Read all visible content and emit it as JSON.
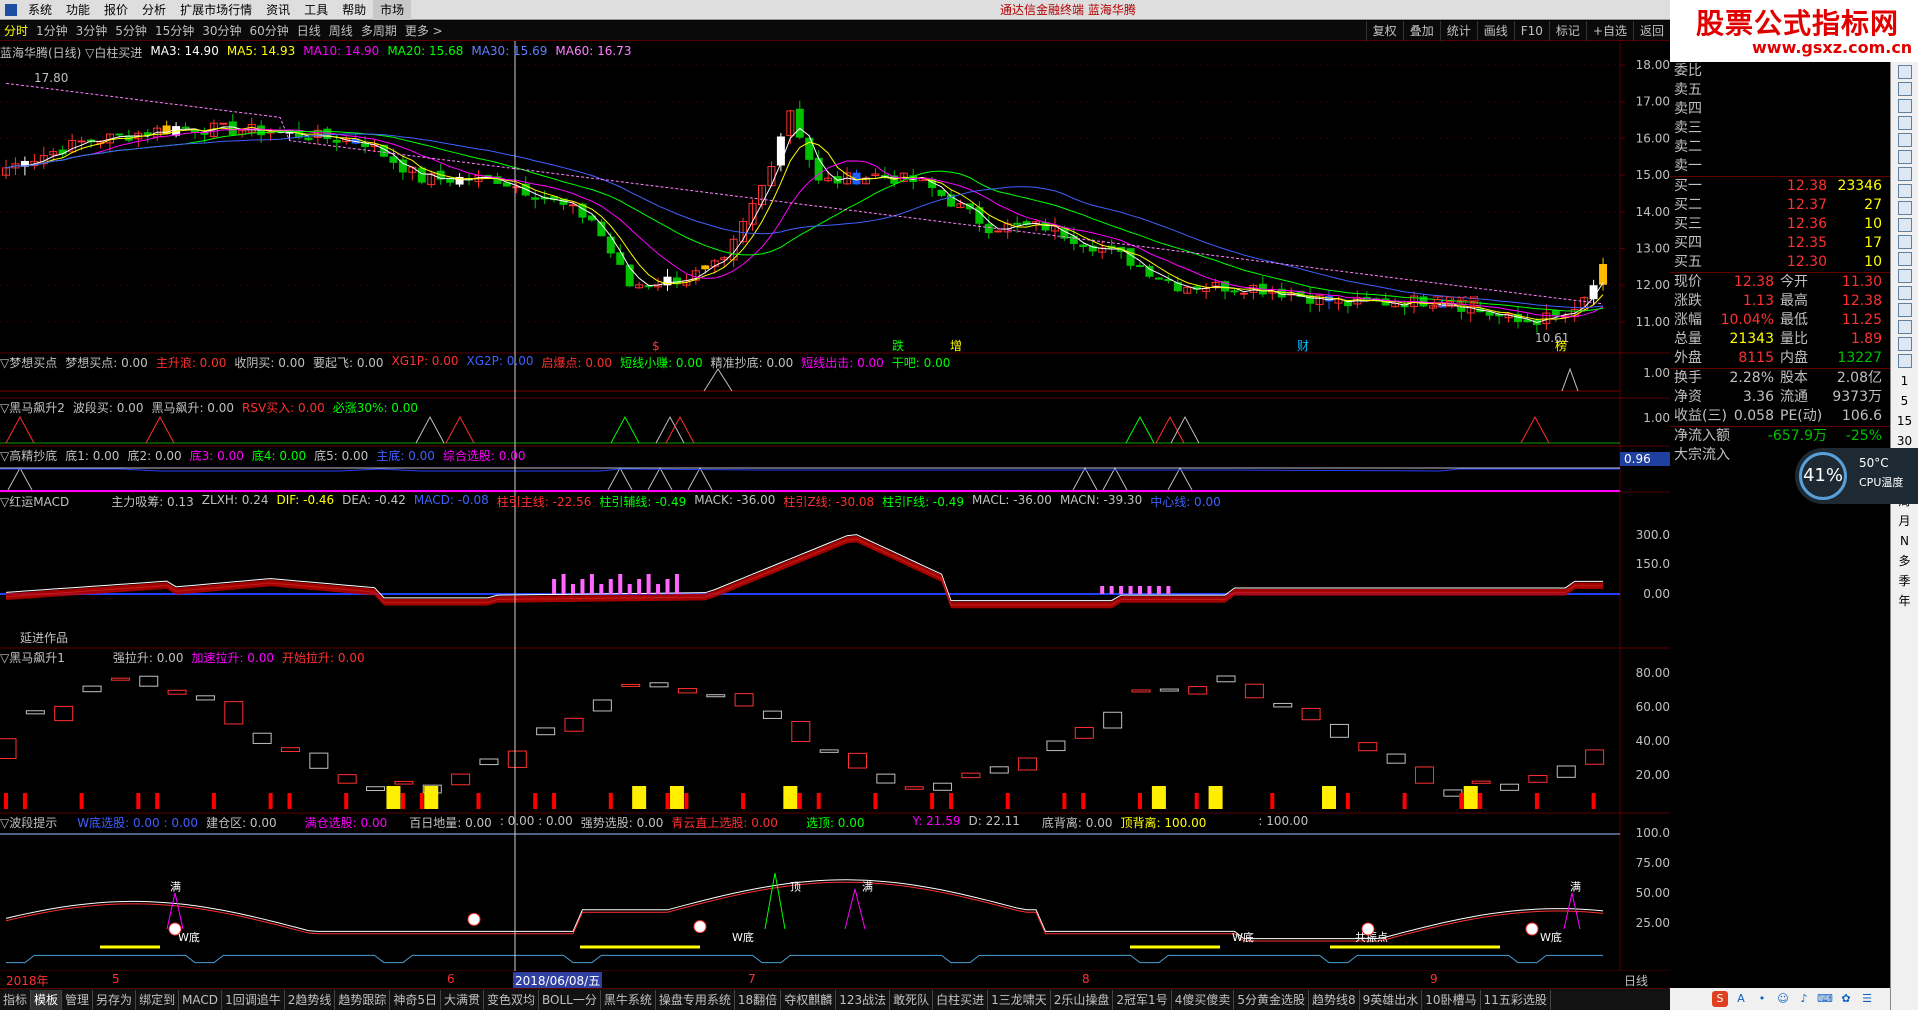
{
  "menu": {
    "items": [
      "系统",
      "功能",
      "报价",
      "分析",
      "扩展市场行情",
      "资讯",
      "工具",
      "帮助",
      "市场"
    ],
    "title": "通达信金融终端 蓝海华腾"
  },
  "period_tabs": [
    "分时",
    "1分钟",
    "3分钟",
    "5分钟",
    "15分钟",
    "30分钟",
    "60分钟",
    "日线",
    "周线",
    "多周期",
    "更多 >"
  ],
  "toolbar_right": [
    "复权",
    "叠加",
    "统计",
    "画线",
    "F10",
    "标记",
    "+自选",
    "返回"
  ],
  "brand": {
    "title": "股票公式指标网",
    "url": "www.gsxz.com.cn"
  },
  "main_info": {
    "name": "蓝海华腾(日线) ▽白柱买进",
    "ma3": "MA3: 14.90",
    "ma5": "MA5: 14.93",
    "ma10": "MA10: 14.90",
    "ma20": "MA20: 15.68",
    "ma30": "MA30: 15.69",
    "ma60": "MA60: 16.73"
  },
  "price_axis": [
    "18.00",
    "17.00",
    "16.00",
    "15.00",
    "14.00",
    "13.00",
    "12.00",
    "11.00"
  ],
  "price_labels": {
    "high": "17.80",
    "low": "10.61",
    "tag": "百日新量"
  },
  "chart_marks": [
    "$",
    "跌",
    "增",
    "财",
    "榜"
  ],
  "panel1": {
    "items": [
      "▽梦想买点",
      "梦想买点: 0.00",
      "主升浪: 0.00",
      "收阴买: 0.00",
      "要起飞: 0.00",
      "XG1P: 0.00",
      "XG2P: 0.00",
      "启爆点: 0.00",
      "短线小赚: 0.00",
      "精准抄底: 0.00",
      "短线出击: 0.00",
      "干吧: 0.00"
    ],
    "axis": "1.00"
  },
  "panel2": {
    "items": [
      "▽黑马飙升2",
      "波段买: 0.00",
      "黑马飙升: 0.00",
      "RSV买入: 0.00",
      "必涨30%: 0.00"
    ],
    "axis": "1.00"
  },
  "panel3": {
    "items": [
      "▽高精抄底",
      "底1: 0.00",
      "底2: 0.00",
      "底3: 0.00",
      "底4: 0.00",
      "底5: 0.00",
      "主底: 0.00",
      "综合选股: 0.00"
    ],
    "axis": "0.96"
  },
  "panel4": {
    "items": [
      "▽红运MACD",
      "主力吸筹: 0.13",
      "ZLXH: 0.24",
      "DIF: -0.46",
      "DEA: -0.42",
      "MACD: -0.08",
      "柱引主线: -22.56",
      "柱引辅线: -0.49",
      "MACK: -36.00",
      "柱引Z线: -30.08",
      "柱引F线: -0.49",
      "MACL: -36.00",
      "MACN: -39.30",
      "中心线: 0.00"
    ],
    "axis": [
      "300.0",
      "150.0",
      "0.00"
    ],
    "note": "延进作品"
  },
  "panel5": {
    "items": [
      "▽黑马飙升1",
      "强拉升: 0.00",
      "加速拉升: 0.00",
      "开始拉升: 0.00"
    ],
    "axis": [
      "80.00",
      "60.00",
      "40.00",
      "20.00"
    ]
  },
  "panel6": {
    "items": [
      "▽波段提示",
      "W底选股: 0.00 : 0.00",
      "建仓区: 0.00",
      "满仓选股: 0.00",
      "百日地量: 0.00",
      ": 0.00 : 0.00",
      "强势选股: 0.00",
      "青云直上选股: 0.00",
      "选顶: 0.00",
      "Y: 21.59",
      "D: 22.11",
      "底背离: 0.00",
      "顶背离: 100.00",
      ": 100.00"
    ],
    "axis": [
      "100.0",
      "75.00",
      "50.00",
      "25.00"
    ],
    "marks": [
      "满",
      "W底",
      "顶",
      "满",
      "W底",
      "W底",
      "共振点",
      "W底",
      "满"
    ]
  },
  "date_axis": {
    "labels": [
      "2018年",
      "5",
      "6",
      "2018/06/08/五",
      "7",
      "8",
      "9"
    ],
    "right": "日线"
  },
  "bottom_tabs": [
    "指标",
    "模板",
    "管理",
    "另存为",
    "绑定到",
    "MACD",
    "1回调追牛",
    "2趋势线",
    "趋势跟踪",
    "神奇5日",
    "大满贯",
    "变色双均",
    "BOLL一分",
    "黑牛系统",
    "操盘专用系统",
    "18翻倍",
    "夺权麒麟",
    "123战法",
    "敢死队",
    "白柱买进",
    "1三龙啸天",
    "2乐山操盘",
    "2冠军1号",
    "4傻买傻卖",
    "5分黄金选股",
    "趋势线8",
    "9英雄出水",
    "10卧槽马",
    "11五彩选股"
  ],
  "quote": {
    "asks": [
      {
        "l": "委比",
        "p": "",
        "v": ""
      },
      {
        "l": "卖五",
        "p": "",
        "v": ""
      },
      {
        "l": "卖四",
        "p": "",
        "v": ""
      },
      {
        "l": "卖三",
        "p": "",
        "v": ""
      },
      {
        "l": "卖二",
        "p": "",
        "v": ""
      },
      {
        "l": "卖一",
        "p": "",
        "v": ""
      }
    ],
    "bids": [
      {
        "l": "买一",
        "p": "12.38",
        "v": "23346"
      },
      {
        "l": "买二",
        "p": "12.37",
        "v": "27"
      },
      {
        "l": "买三",
        "p": "12.36",
        "v": "10"
      },
      {
        "l": "买四",
        "p": "12.35",
        "v": "17"
      },
      {
        "l": "买五",
        "p": "12.30",
        "v": "10"
      }
    ],
    "stats": [
      {
        "l1": "现价",
        "v1": "12.38",
        "l2": "今开",
        "v2": "11.30"
      },
      {
        "l1": "涨跌",
        "v1": "1.13",
        "l2": "最高",
        "v2": "12.38"
      },
      {
        "l1": "涨幅",
        "v1": "10.04%",
        "l2": "最低",
        "v2": "11.25"
      },
      {
        "l1": "总量",
        "v1": "21343",
        "l2": "量比",
        "v2": "1.89"
      },
      {
        "l1": "外盘",
        "v1": "8115",
        "l2": "内盘",
        "v2": "13227"
      }
    ],
    "stats2": [
      {
        "l1": "换手",
        "v1": "2.28%",
        "l2": "股本",
        "v2": "2.08亿"
      },
      {
        "l1": "净资",
        "v1": "3.36",
        "l2": "流通",
        "v2": "9373万"
      },
      {
        "l1": "收益(三)",
        "v1": "0.058",
        "l2": "PE(动)",
        "v2": "106.6"
      }
    ],
    "flow": [
      {
        "l": "净流入额",
        "v": "-657.9万",
        "p": "-25%"
      },
      {
        "l": "大宗流入",
        "v": "",
        "p": ""
      }
    ]
  },
  "cpu": {
    "pct": "41%",
    "temp": "50°C",
    "label": "CPU温度"
  },
  "sidebar": [
    "日",
    "周",
    "月",
    "N",
    "多",
    "季",
    "年"
  ],
  "sidebar_nums": [
    "1",
    "5",
    "15",
    "30",
    "60"
  ],
  "colors": {
    "up": "#ff3030",
    "down": "#00c000",
    "ma3": "#ffffff",
    "ma5": "#ffff00",
    "ma10": "#ff00ff",
    "ma20": "#00ff00",
    "ma30": "#4060ff",
    "grid": "#5a0000"
  }
}
